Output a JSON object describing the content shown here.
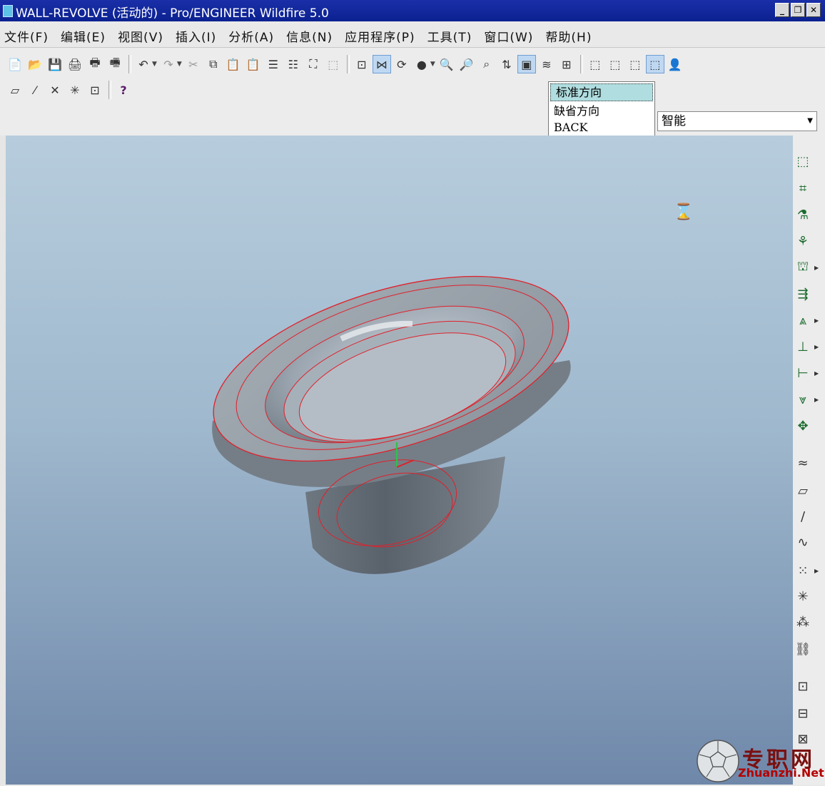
{
  "window": {
    "title": "WALL-REVOLVE (活动的) - Pro/ENGINEER Wildfire 5.0",
    "controls": [
      "_",
      "❐",
      "✕"
    ]
  },
  "menu": [
    "文件(F)",
    "编辑(E)",
    "视图(V)",
    "插入(I)",
    "分析(A)",
    "信息(N)",
    "应用程序(P)",
    "工具(T)",
    "窗口(W)",
    "帮助(H)"
  ],
  "toolbar1": {
    "file": [
      "📄",
      "📂",
      "💾",
      "🖨",
      "🖶",
      "🖷"
    ],
    "edit": [
      "↶",
      "↷",
      "✂",
      "⧉",
      "📋",
      "📋",
      "☰",
      "☷",
      "⛶",
      "⬚"
    ],
    "view": [
      "⊡",
      "⋈",
      "⟳",
      "●",
      "🔍",
      "🔎",
      "⌕",
      "⇅",
      "▣",
      "≋",
      "⊞"
    ],
    "display": [
      "⬚",
      "⬚",
      "⬚",
      "⬚",
      "👤"
    ]
  },
  "toolbar2": [
    "⏥",
    "⁄",
    "✕",
    "✳",
    "⊡",
    "?"
  ],
  "view_dropdown": {
    "items": [
      "标准方向",
      "缺省方向",
      "BACK"
    ],
    "selected_index": 0
  },
  "filter": {
    "value": "智能"
  },
  "right_toolbar": [
    "⬚",
    "⌗",
    "⚗",
    "⚘",
    "⛫",
    "⇶",
    "⩓",
    "⊥",
    "⊢",
    "⩔",
    "✥",
    "≈",
    "▱",
    "/",
    "∿",
    "⁙",
    "✳",
    "⁂",
    "⛓",
    "⊡",
    "⊟",
    "⊠"
  ],
  "watermark": {
    "cn": "专职网",
    "en": "Zhuanzhi.Net"
  },
  "colors": {
    "titlebar": "#0b2190",
    "edge": "#e0202a",
    "model": "#9aa3ad"
  }
}
